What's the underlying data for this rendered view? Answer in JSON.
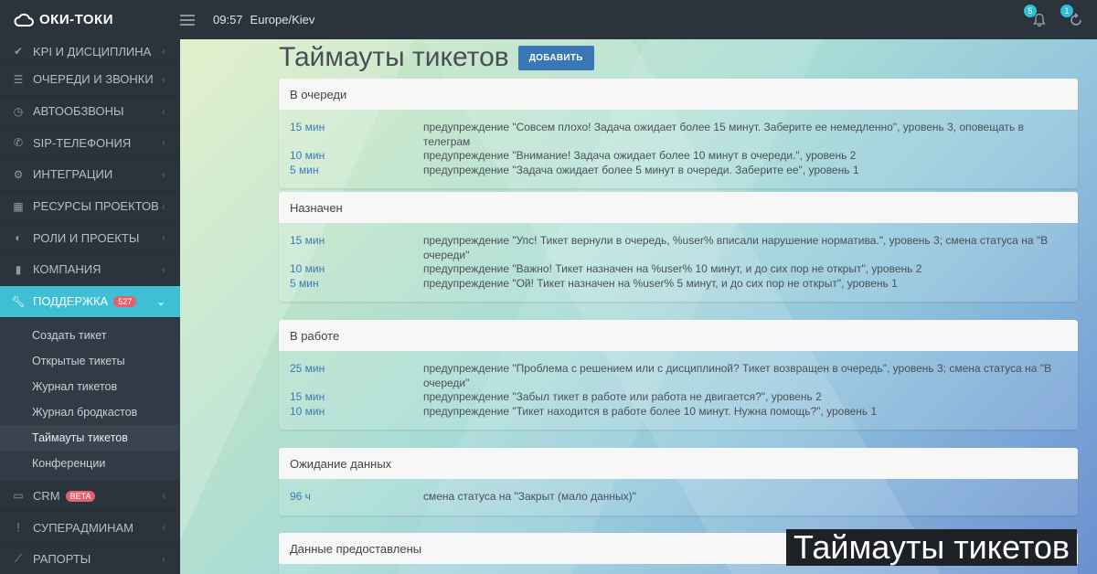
{
  "topbar": {
    "brand": "ОКИ-ТОКИ",
    "time": "09:57",
    "timezone": "Europe/Kiev",
    "notifications_count": "5",
    "sync_count": "1"
  },
  "sidebar": {
    "items": [
      {
        "label": "KPI И ДИСЦИПЛИНА",
        "icon": "check-icon"
      },
      {
        "label": "ОЧЕРЕДИ И ЗВОНКИ",
        "icon": "list-icon"
      },
      {
        "label": "АВТООБЗВОНЫ",
        "icon": "clock-icon"
      },
      {
        "label": "SIP-ТЕЛЕФОНИЯ",
        "icon": "phone-icon"
      },
      {
        "label": "ИНТЕГРАЦИИ",
        "icon": "gears-icon"
      },
      {
        "label": "РЕСУРСЫ ПРОЕКТОВ",
        "icon": "grid-icon"
      },
      {
        "label": "РОЛИ И ПРОЕКТЫ",
        "icon": "toggle-icon"
      },
      {
        "label": "КОМПАНИЯ",
        "icon": "bar-chart-icon"
      },
      {
        "label": "ПОДДЕРЖКА",
        "icon": "wrench-icon",
        "badge": "527"
      }
    ],
    "support_sub": [
      "Создать тикет",
      "Открытые тикеты",
      "Журнал тикетов",
      "Журнал бродкастов",
      "Таймауты тикетов",
      "Конференции"
    ],
    "lower_items": [
      {
        "label": "CRM",
        "icon": "card-icon",
        "badge": "BETA"
      },
      {
        "label": "СУПЕРАДМИНАМ",
        "icon": "exclamation-icon"
      },
      {
        "label": "РАПОРТЫ",
        "icon": "line-chart-icon"
      }
    ]
  },
  "page": {
    "title": "Таймауты тикетов",
    "add_button": "ДОБАВИТЬ"
  },
  "panels": [
    {
      "title": "В очереди",
      "rows": [
        {
          "time": "15 мин",
          "desc": "предупреждение \"Совсем плохо! Задача ожидает более 15 минут. Заберите ее немедленно\", уровень 3, оповещать в телеграм"
        },
        {
          "time": "10 мин",
          "desc": "предупреждение \"Внимание! Задача ожидает более 10 минут в очереди.\", уровень 2"
        },
        {
          "time": "5 мин",
          "desc": "предупреждение \"Задача ожидает более 5 минут в очереди. Заберите ее\", уровень 1"
        }
      ]
    },
    {
      "title": "Назначен",
      "rows": [
        {
          "time": "15 мин",
          "desc": "предупреждение \"Упс! Тикет вернули в очередь, %user% вписали нарушение норматива.\", уровень 3; смена статуса на \"В очереди\""
        },
        {
          "time": "10 мин",
          "desc": "предупреждение \"Важно! Тикет назначен на %user% 10 минут, и до сих пор не открыт\", уровень 2"
        },
        {
          "time": "5 мин",
          "desc": "предупреждение \"Ой! Тикет назначен на %user% 5 минут, и до сих пор не открыт\", уровень 1"
        }
      ]
    },
    {
      "title": "В работе",
      "rows": [
        {
          "time": "25 мин",
          "desc": "предупреждение \"Проблема с решением или с дисциплиной? Тикет возвращен в очередь\", уровень 3; смена статуса на \"В очереди\""
        },
        {
          "time": "15 мин",
          "desc": "предупреждение \"Забыл тикет в работе или работа не двигается?\", уровень 2"
        },
        {
          "time": "10 мин",
          "desc": "предупреждение \"Тикет находится в работе более 10 минут. Нужна помощь?\", уровень 1"
        }
      ]
    },
    {
      "title": "Ожидание данных",
      "rows": [
        {
          "time": "96 ч",
          "desc": "смена статуса на \"Закрыт (мало данных)\""
        }
      ]
    },
    {
      "title": "Данные предоставлены",
      "rows": []
    }
  ],
  "caption": "Таймауты тикетов",
  "colors": {
    "accent": "#3ebfd4",
    "button": "#3a77b6",
    "badge_red": "#e4606d",
    "sidebar_bg": "#2b333c"
  }
}
